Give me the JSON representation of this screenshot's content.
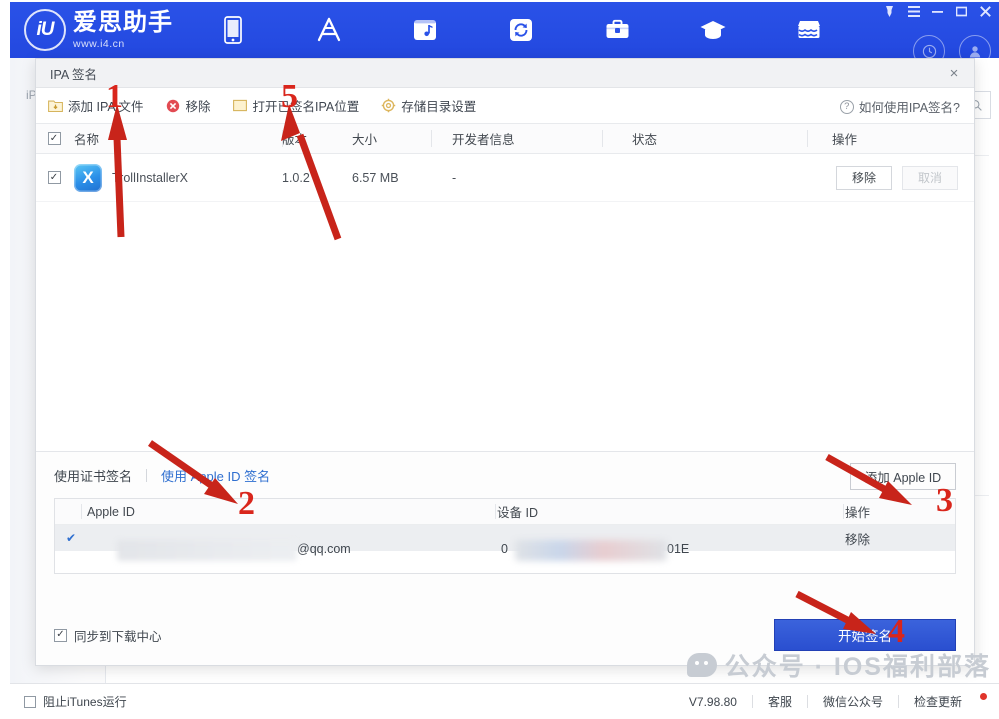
{
  "header": {
    "brand_mark": "iU",
    "brand_name": "爱思助手",
    "brand_url": "www.i4.cn",
    "nav_items": [
      {
        "name": "device-icon",
        "label": "设备"
      },
      {
        "name": "appstore-icon",
        "label": "应用"
      },
      {
        "name": "music-icon",
        "label": "音乐"
      },
      {
        "name": "refresh-icon",
        "label": "刷机越狱"
      },
      {
        "name": "toolbox-icon",
        "label": "工具箱"
      },
      {
        "name": "graduation-icon",
        "label": "教程"
      },
      {
        "name": "store-icon",
        "label": "商店"
      }
    ],
    "window_controls": [
      "pin",
      "menu",
      "minimize",
      "maximize",
      "close"
    ],
    "circle_icons": [
      "history-icon",
      "account-icon"
    ]
  },
  "background": {
    "sidebar_label": "iP",
    "search_icon": "search-icon"
  },
  "modal": {
    "title": "IPA 签名",
    "close_label": "×",
    "toolbar": {
      "add_ipa": "添加 IPA 文件",
      "remove": "移除",
      "open_signed_location": "打开已签名IPA位置",
      "storage_settings": "存储目录设置",
      "help": "如何使用IPA签名?"
    },
    "table": {
      "headers": [
        "名称",
        "版本",
        "大小",
        "开发者信息",
        "状态",
        "操作"
      ],
      "header_checked": true,
      "rows": [
        {
          "checked": true,
          "icon_letter": "X",
          "name": "TrollInstallerX",
          "version": "1.0.2",
          "size": "6.57 MB",
          "developer": "-",
          "status": "",
          "action_primary": "移除",
          "action_secondary": "取消",
          "action_secondary_disabled": true
        }
      ]
    },
    "sign_panel": {
      "tab_cert": "使用证书签名",
      "tab_appleid": "使用 Apple ID 签名",
      "active_tab": "使用 Apple ID 签名",
      "add_apple_id_button": "添加 Apple ID",
      "id_table": {
        "headers": [
          "Apple ID",
          "设备 ID",
          "操作"
        ],
        "rows": [
          {
            "checked": true,
            "apple_id": "@qq.com",
            "apple_id_redacted": true,
            "device_id_prefix": "0",
            "device_id_suffix": "01E",
            "device_id_redacted": true,
            "action": "移除"
          }
        ]
      },
      "sync_label": "同步到下载中心",
      "sync_checked": true,
      "start_sign_button": "开始签名"
    }
  },
  "statusbar": {
    "block_itunes": "阻止iTunes运行",
    "block_itunes_checked": false,
    "version": "V7.98.80",
    "support": "客服",
    "wechat": "微信公众号",
    "check_update": "检查更新"
  },
  "watermark": {
    "text": "公众号 · IOS福利部落"
  },
  "annotations": [
    {
      "number": "1",
      "target": "添加 IPA 文件"
    },
    {
      "number": "2",
      "target": "使用 Apple ID 签名"
    },
    {
      "number": "3",
      "target": "添加 Apple ID"
    },
    {
      "number": "4",
      "target": "开始签名"
    },
    {
      "number": "5",
      "target": "打开已签名IPA位置"
    }
  ],
  "colors": {
    "header_blue": "#2a52e8",
    "primary_button": "#2a4fd0",
    "annotation_red": "#d9261c",
    "link_blue": "#2f6fd0"
  }
}
